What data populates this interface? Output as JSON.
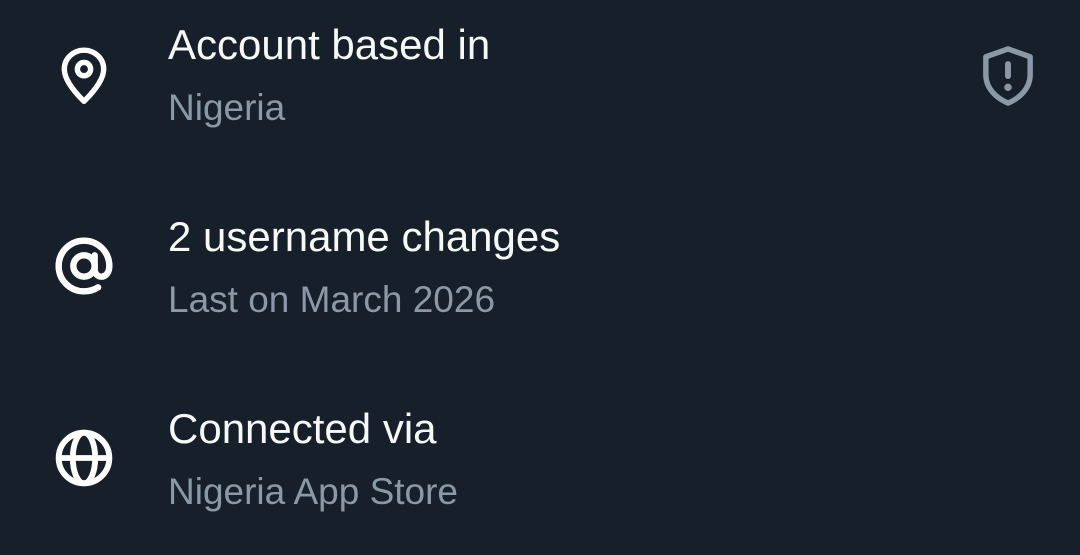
{
  "rows": [
    {
      "icon": "location-pin-icon",
      "title": "Account based in",
      "subtitle": "Nigeria",
      "badge_icon": "shield-alert-icon"
    },
    {
      "icon": "at-sign-icon",
      "title": "2 username changes",
      "subtitle": "Last on March 2026"
    },
    {
      "icon": "globe-icon",
      "title": "Connected via",
      "subtitle": "Nigeria App Store"
    }
  ],
  "colors": {
    "background": "#17202a",
    "title": "#f7f9f9",
    "subtitle": "#8b98a5",
    "shield": "#8b98a5"
  }
}
